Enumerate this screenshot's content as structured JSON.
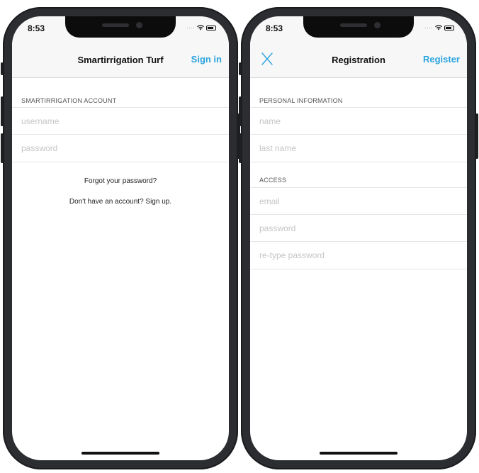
{
  "signin_screen": {
    "status": {
      "time": "8:53"
    },
    "nav": {
      "title": "Smartirrigation Turf",
      "action": "Sign in"
    },
    "section_header": "SMARTIRRIGATION ACCOUNT",
    "fields": {
      "username_placeholder": "username",
      "password_placeholder": "password"
    },
    "links": {
      "forgot": "Forgot your password?",
      "signup": "Don't have an account? Sign up."
    }
  },
  "registration_screen": {
    "status": {
      "time": "8:53"
    },
    "nav": {
      "title": "Registration",
      "action": "Register",
      "close_icon": "close-icon"
    },
    "personal": {
      "header": "PERSONAL INFORMATION",
      "name_placeholder": "name",
      "lastname_placeholder": "last name"
    },
    "access": {
      "header": "ACCESS",
      "email_placeholder": "email",
      "password_placeholder": "password",
      "retype_placeholder": "re-type password"
    }
  },
  "colors": {
    "accent": "#2aa4de",
    "nav_background": "#f7f7f7",
    "phone_frame": "#2c2d30"
  }
}
